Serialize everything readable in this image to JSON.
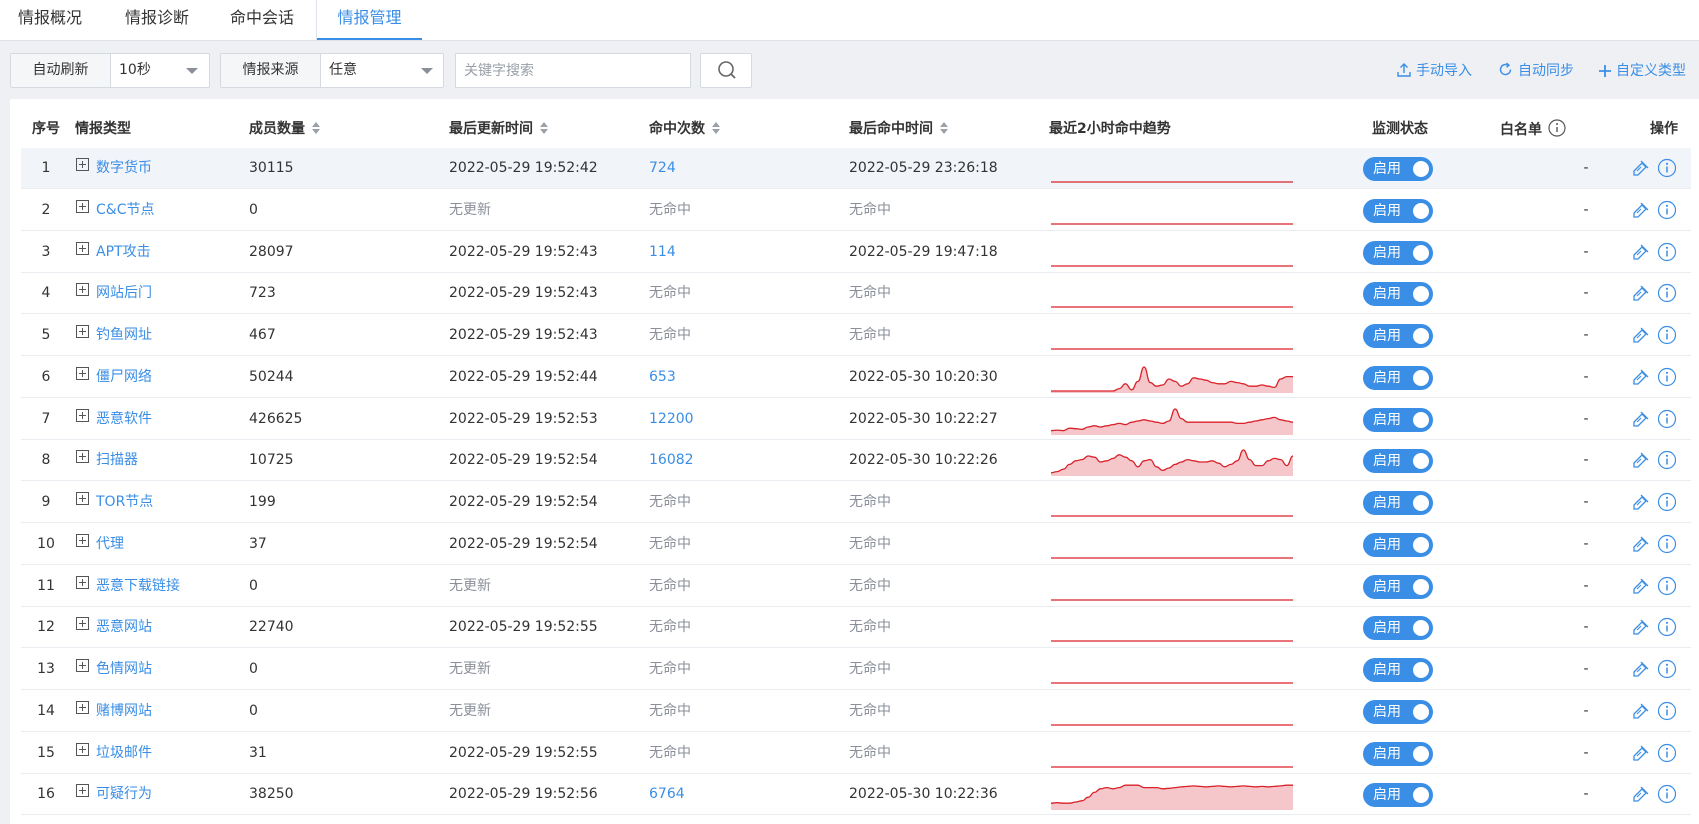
{
  "tabs": [
    {
      "label": "情报概况"
    },
    {
      "label": "情报诊断"
    },
    {
      "label": "命中会话"
    },
    {
      "label": "情报管理"
    }
  ],
  "toolbar": {
    "auto_refresh_label": "自动刷新",
    "auto_refresh_value": "10秒",
    "source_label": "情报来源",
    "source_value": "任意",
    "search_placeholder": "关键字搜索",
    "import_label": "手动导入",
    "sync_label": "自动同步",
    "custom_label": "自定义类型"
  },
  "table": {
    "headers": {
      "num": "序号",
      "type": "情报类型",
      "members": "成员数量",
      "updated": "最后更新时间",
      "hits": "命中次数",
      "last_hit": "最后命中时间",
      "trend": "最近2小时命中趋势",
      "status": "监测状态",
      "whitelist": "白名单",
      "actions": "操作"
    },
    "status_label": "启用",
    "rows": [
      {
        "num": "1",
        "type": "数字货币",
        "members": "30115",
        "updated": "2022-05-29 19:52:42",
        "hits": "724",
        "last_hit": "2022-05-29 23:26:18",
        "whitelist": "-",
        "trend": [
          0,
          0,
          0,
          0,
          0,
          0,
          0,
          0,
          0,
          0,
          0,
          0,
          0,
          0,
          0,
          0,
          0,
          0,
          0,
          0,
          0,
          0,
          0,
          0,
          0,
          0,
          0,
          0,
          0,
          0,
          0,
          0,
          0,
          0,
          0,
          0,
          0,
          0,
          0,
          0
        ]
      },
      {
        "num": "2",
        "type": "C&C节点",
        "members": "0",
        "updated": "无更新",
        "hits": "无命中",
        "last_hit": "无命中",
        "whitelist": "-",
        "trend": [
          0,
          0,
          0,
          0,
          0,
          0,
          0,
          0,
          0,
          0,
          0,
          0,
          0,
          0,
          0,
          0,
          0,
          0,
          0,
          0,
          0,
          0,
          0,
          0,
          0,
          0,
          0,
          0,
          0,
          0,
          0,
          0,
          0,
          0,
          0,
          0,
          0,
          0,
          0,
          0
        ]
      },
      {
        "num": "3",
        "type": "APT攻击",
        "members": "28097",
        "updated": "2022-05-29 19:52:43",
        "hits": "114",
        "last_hit": "2022-05-29 19:47:18",
        "whitelist": "-",
        "trend": [
          0,
          0,
          0,
          0,
          0,
          0,
          0,
          0,
          0,
          0,
          0,
          0,
          0,
          0,
          0,
          0,
          0,
          0,
          0,
          0,
          0,
          0,
          0,
          0,
          0,
          0,
          0,
          0,
          0,
          0,
          0,
          0,
          0,
          0,
          0,
          0,
          0,
          0,
          0,
          0
        ]
      },
      {
        "num": "4",
        "type": "网站后门",
        "members": "723",
        "updated": "2022-05-29 19:52:43",
        "hits": "无命中",
        "last_hit": "无命中",
        "whitelist": "-",
        "trend": [
          0,
          0,
          0,
          0,
          0,
          0,
          0,
          0,
          0,
          0,
          0,
          0,
          0,
          0,
          0,
          0,
          0,
          0,
          0,
          0,
          0,
          0,
          0,
          0,
          0,
          0,
          0,
          0,
          0,
          0,
          0,
          0,
          0,
          0,
          0,
          0,
          0,
          0,
          0,
          0
        ]
      },
      {
        "num": "5",
        "type": "钓鱼网址",
        "members": "467",
        "updated": "2022-05-29 19:52:43",
        "hits": "无命中",
        "last_hit": "无命中",
        "whitelist": "-",
        "trend": [
          0,
          0,
          0,
          0,
          0,
          0,
          0,
          0,
          0,
          0,
          0,
          0,
          0,
          0,
          0,
          0,
          0,
          0,
          0,
          0,
          0,
          0,
          0,
          0,
          0,
          0,
          0,
          0,
          0,
          0,
          0,
          0,
          0,
          0,
          0,
          0,
          0,
          0,
          0,
          0
        ]
      },
      {
        "num": "6",
        "type": "僵尸网络",
        "members": "50244",
        "updated": "2022-05-29 19:52:44",
        "hits": "653",
        "last_hit": "2022-05-30 10:20:30",
        "whitelist": "-",
        "trend": [
          0,
          0,
          0,
          0,
          0,
          0,
          0,
          0,
          0,
          0,
          0,
          0.1,
          0.3,
          0.05,
          0.4,
          1,
          0.35,
          0.2,
          0.25,
          0.5,
          0.4,
          0.2,
          0.3,
          0.55,
          0.5,
          0.45,
          0.35,
          0.3,
          0.3,
          0.4,
          0.35,
          0.3,
          0.2,
          0.2,
          0.25,
          0.2,
          0.15,
          0.5,
          0.6,
          0.6
        ]
      },
      {
        "num": "7",
        "type": "恶意软件",
        "members": "426625",
        "updated": "2022-05-29 19:52:53",
        "hits": "12200",
        "last_hit": "2022-05-30 10:22:27",
        "whitelist": "-",
        "trend": [
          0.1,
          0.12,
          0.1,
          0.2,
          0.18,
          0.15,
          0.25,
          0.3,
          0.25,
          0.3,
          0.35,
          0.4,
          0.35,
          0.45,
          0.5,
          0.55,
          0.5,
          0.45,
          0.4,
          0.5,
          1,
          0.6,
          0.45,
          0.45,
          0.45,
          0.45,
          0.45,
          0.45,
          0.45,
          0.45,
          0.4,
          0.4,
          0.45,
          0.5,
          0.55,
          0.6,
          0.65,
          0.55,
          0.5,
          0.45
        ]
      },
      {
        "num": "8",
        "type": "扫描器",
        "members": "10725",
        "updated": "2022-05-29 19:52:54",
        "hits": "16082",
        "last_hit": "2022-05-30 10:22:26",
        "whitelist": "-",
        "trend": [
          0.05,
          0.1,
          0.2,
          0.4,
          0.55,
          0.6,
          0.75,
          0.7,
          0.5,
          0.55,
          0.65,
          0.8,
          0.7,
          0.55,
          0.3,
          0.55,
          0.6,
          0.3,
          0.15,
          0.25,
          0.4,
          0.5,
          0.6,
          0.55,
          0.5,
          0.5,
          0.55,
          0.45,
          0.3,
          0.4,
          0.55,
          1,
          0.6,
          0.35,
          0.35,
          0.55,
          0.65,
          0.6,
          0.35,
          0.75
        ]
      },
      {
        "num": "9",
        "type": "TOR节点",
        "members": "199",
        "updated": "2022-05-29 19:52:54",
        "hits": "无命中",
        "last_hit": "无命中",
        "whitelist": "-",
        "trend": [
          0,
          0,
          0,
          0,
          0,
          0,
          0,
          0,
          0,
          0,
          0,
          0,
          0,
          0,
          0,
          0,
          0,
          0,
          0,
          0,
          0,
          0,
          0,
          0,
          0,
          0,
          0,
          0,
          0,
          0,
          0,
          0,
          0,
          0,
          0,
          0,
          0,
          0,
          0,
          0
        ]
      },
      {
        "num": "10",
        "type": "代理",
        "members": "37",
        "updated": "2022-05-29 19:52:54",
        "hits": "无命中",
        "last_hit": "无命中",
        "whitelist": "-",
        "trend": [
          0,
          0,
          0,
          0,
          0,
          0,
          0,
          0,
          0,
          0,
          0,
          0,
          0,
          0,
          0,
          0,
          0,
          0,
          0,
          0,
          0,
          0,
          0,
          0,
          0,
          0,
          0,
          0,
          0,
          0,
          0,
          0,
          0,
          0,
          0,
          0,
          0,
          0,
          0,
          0
        ]
      },
      {
        "num": "11",
        "type": "恶意下载链接",
        "members": "0",
        "updated": "无更新",
        "hits": "无命中",
        "last_hit": "无命中",
        "whitelist": "-",
        "trend": [
          0,
          0,
          0,
          0,
          0,
          0,
          0,
          0,
          0,
          0,
          0,
          0,
          0,
          0,
          0,
          0,
          0,
          0,
          0,
          0,
          0,
          0,
          0,
          0,
          0,
          0,
          0,
          0,
          0,
          0,
          0,
          0,
          0,
          0,
          0,
          0,
          0,
          0,
          0,
          0
        ]
      },
      {
        "num": "12",
        "type": "恶意网站",
        "members": "22740",
        "updated": "2022-05-29 19:52:55",
        "hits": "无命中",
        "last_hit": "无命中",
        "whitelist": "-",
        "trend": [
          0,
          0,
          0,
          0,
          0,
          0,
          0,
          0,
          0,
          0,
          0,
          0,
          0,
          0,
          0,
          0,
          0,
          0,
          0,
          0,
          0,
          0,
          0,
          0,
          0,
          0,
          0,
          0,
          0,
          0,
          0,
          0,
          0,
          0,
          0,
          0,
          0,
          0,
          0,
          0
        ]
      },
      {
        "num": "13",
        "type": "色情网站",
        "members": "0",
        "updated": "无更新",
        "hits": "无命中",
        "last_hit": "无命中",
        "whitelist": "-",
        "trend": [
          0,
          0,
          0,
          0,
          0,
          0,
          0,
          0,
          0,
          0,
          0,
          0,
          0,
          0,
          0,
          0,
          0,
          0,
          0,
          0,
          0,
          0,
          0,
          0,
          0,
          0,
          0,
          0,
          0,
          0,
          0,
          0,
          0,
          0,
          0,
          0,
          0,
          0,
          0,
          0
        ]
      },
      {
        "num": "14",
        "type": "赌博网站",
        "members": "0",
        "updated": "无更新",
        "hits": "无命中",
        "last_hit": "无命中",
        "whitelist": "-",
        "trend": [
          0,
          0,
          0,
          0,
          0,
          0,
          0,
          0,
          0,
          0,
          0,
          0,
          0,
          0,
          0,
          0,
          0,
          0,
          0,
          0,
          0,
          0,
          0,
          0,
          0,
          0,
          0,
          0,
          0,
          0,
          0,
          0,
          0,
          0,
          0,
          0,
          0,
          0,
          0,
          0
        ]
      },
      {
        "num": "15",
        "type": "垃圾邮件",
        "members": "31",
        "updated": "2022-05-29 19:52:55",
        "hits": "无命中",
        "last_hit": "无命中",
        "whitelist": "-",
        "trend": [
          0,
          0,
          0,
          0,
          0,
          0,
          0,
          0,
          0,
          0,
          0,
          0,
          0,
          0,
          0,
          0,
          0,
          0,
          0,
          0,
          0,
          0,
          0,
          0,
          0,
          0,
          0,
          0,
          0,
          0,
          0,
          0,
          0,
          0,
          0,
          0,
          0,
          0,
          0,
          0
        ]
      },
      {
        "num": "16",
        "type": "可疑行为",
        "members": "38250",
        "updated": "2022-05-29 19:52:56",
        "hits": "6764",
        "last_hit": "2022-05-30 10:22:36",
        "whitelist": "-",
        "trend": [
          0.2,
          0.22,
          0.2,
          0.2,
          0.25,
          0.3,
          0.45,
          0.65,
          0.8,
          0.85,
          0.8,
          0.85,
          0.95,
          0.95,
          0.95,
          0.85,
          0.85,
          0.85,
          0.8,
          0.82,
          0.85,
          0.88,
          0.9,
          0.92,
          0.9,
          0.88,
          0.9,
          0.92,
          0.9,
          0.88,
          0.9,
          0.92,
          0.9,
          0.88,
          0.9,
          0.88,
          0.9,
          0.92,
          0.95,
          0.95
        ]
      }
    ]
  },
  "colors": {
    "accent": "#3a8ee6",
    "trend_line": "#d9222a",
    "trend_fill": "#f2b8bd"
  },
  "icons": {
    "import": "upload-icon",
    "sync": "refresh-icon",
    "custom": "plus-icon",
    "search": "search-icon",
    "edit": "edit-icon",
    "info": "info-icon"
  }
}
